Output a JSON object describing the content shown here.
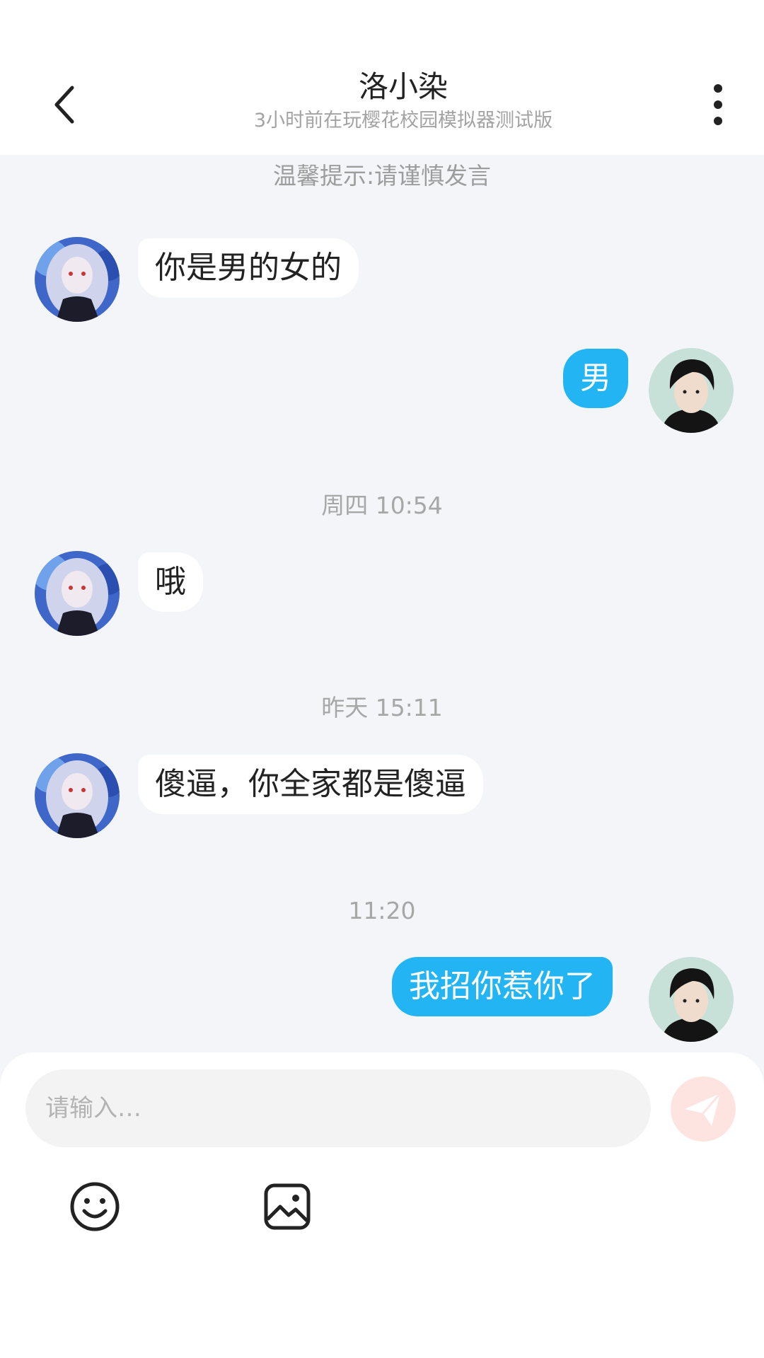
{
  "header": {
    "title": "洛小染",
    "subtitle": "3小时前在玩樱花校园模拟器测试版",
    "back_icon": "chevron-left-icon",
    "more_icon": "more-vertical-icon"
  },
  "tip": "温馨提示:请谨慎发言",
  "messages": [
    {
      "side": "in",
      "text": "你是男的女的"
    },
    {
      "side": "out",
      "text": "男"
    },
    {
      "side": "in",
      "text": "哦"
    },
    {
      "side": "in",
      "text": "傻逼，你全家都是傻逼"
    },
    {
      "side": "out",
      "text": "我招你惹你了"
    }
  ],
  "timestamps": [
    "周四 10:54",
    "昨天 15:11",
    "11:20"
  ],
  "composer": {
    "placeholder": "请输入…",
    "send_icon": "send-icon",
    "emoji_icon": "emoji-icon",
    "image_icon": "image-icon"
  },
  "colors": {
    "outgoing_bubble": "#23b4f3",
    "background": "#f3f5f8",
    "send_button": "#fde4e0"
  }
}
